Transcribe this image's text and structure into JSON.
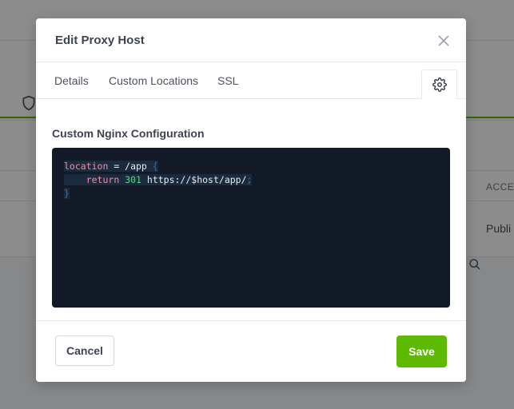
{
  "background": {
    "table_header_access": "ACCES",
    "table_cell_access": "Publi"
  },
  "modal": {
    "title": "Edit Proxy Host",
    "tabs": [
      {
        "label": "Details"
      },
      {
        "label": "Custom Locations"
      },
      {
        "label": "SSL"
      }
    ],
    "active_tab_icon": "gear-icon",
    "section_label": "Custom Nginx Configuration",
    "code": {
      "line1": {
        "keyword": "location",
        "rest": " = /app ",
        "brace": "{"
      },
      "line2": {
        "indent": "    ",
        "keyword": "return",
        "space": " ",
        "number": "301",
        "rest": " https://$host/app/",
        "semicolon": ";"
      },
      "line3": {
        "brace": "}"
      }
    },
    "footer": {
      "cancel_label": "Cancel",
      "save_label": "Save"
    }
  },
  "colors": {
    "accent": "#5eba00",
    "editor_bg": "#131a27"
  }
}
